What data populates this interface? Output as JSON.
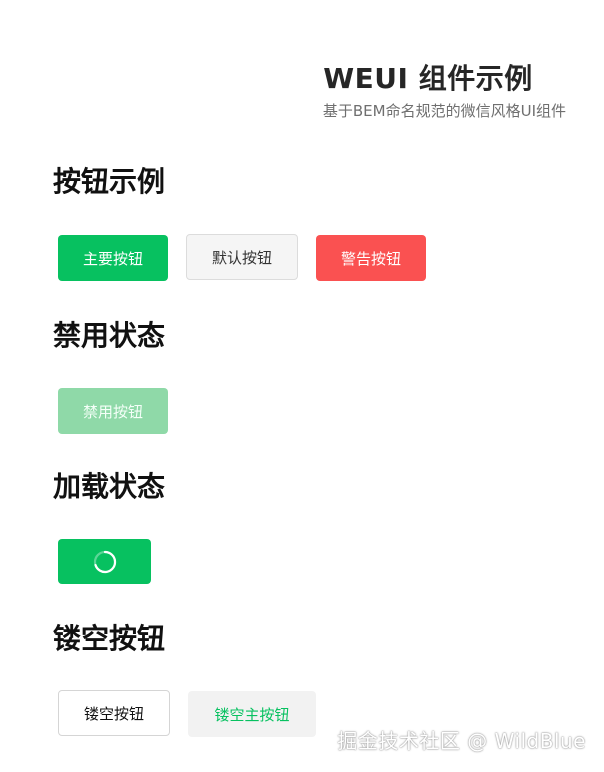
{
  "header": {
    "title": "WEUI 组件示例",
    "subtitle": "基于BEM命名规范的微信风格UI组件"
  },
  "sections": {
    "buttons": {
      "title": "按钮示例",
      "primary_label": "主要按钮",
      "default_label": "默认按钮",
      "warn_label": "警告按钮"
    },
    "disabled": {
      "title": "禁用状态",
      "button_label": "禁用按钮"
    },
    "loading": {
      "title": "加载状态"
    },
    "plain": {
      "title": "镂空按钮",
      "plain_label": "镂空按钮",
      "plain_primary_label": "镂空主按钮"
    }
  },
  "watermark": "掘金技术社区 @ WildBlue",
  "colors": {
    "primary": "#07c160",
    "warn": "#fa5151",
    "disabled": "#8fd9a8",
    "default_bg": "#f5f5f5"
  }
}
